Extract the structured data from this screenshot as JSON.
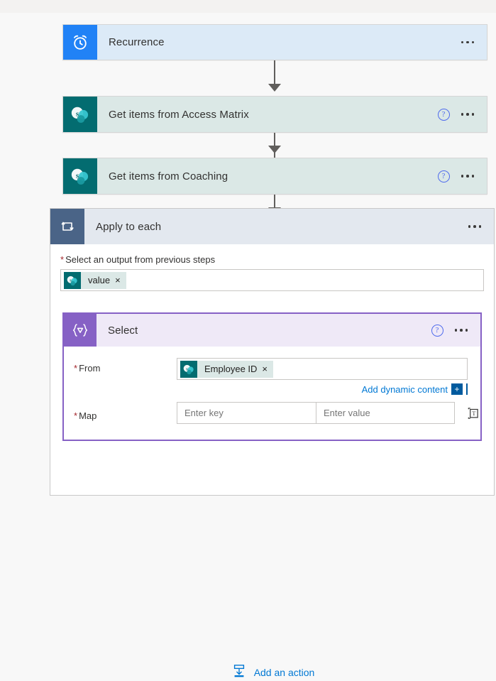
{
  "flow": {
    "steps": [
      {
        "id": "recurrence",
        "title": "Recurrence",
        "icon": "alarm-clock-icon",
        "icon_color": "#2182f6",
        "body_color": "#dceaf7",
        "has_help": false
      },
      {
        "id": "get-items-access-matrix",
        "title": "Get items from Access Matrix",
        "icon": "sharepoint-icon",
        "icon_color": "#036c70",
        "body_color": "#dbe8e6",
        "has_help": true
      },
      {
        "id": "get-items-coaching",
        "title": "Get items from Coaching",
        "icon": "sharepoint-icon",
        "icon_color": "#036c70",
        "body_color": "#dbe8e6",
        "has_help": true
      }
    ],
    "apply_to_each": {
      "title": "Apply to each",
      "icon": "loop-icon",
      "icon_color": "#4a6487",
      "header_color": "#e3e8ef",
      "output_field": {
        "label": "Select an output from previous steps",
        "required_marker": "*",
        "token": {
          "text": "value",
          "icon": "sharepoint-icon",
          "remove_label": "×"
        }
      },
      "select_action": {
        "title": "Select",
        "icon": "select-braces-icon",
        "icon_color": "#8661c5",
        "header_color": "#efe9f7",
        "border_color": "#8661c5",
        "params": [
          {
            "label": "From",
            "required_marker": "*",
            "token": {
              "text": "Employee ID",
              "icon": "sharepoint-icon",
              "remove_label": "×"
            }
          }
        ],
        "dynamic_content": {
          "label": "Add dynamic content",
          "plus_label": "+"
        },
        "map": {
          "label": "Map",
          "required_marker": "*",
          "key_placeholder": "Enter key",
          "key_value": "",
          "value_placeholder": "Enter value",
          "value_value": "",
          "text_mode_icon": "switch-to-text-mode-icon"
        }
      },
      "add_action": {
        "label": "Add an action",
        "icon": "insert-action-icon"
      }
    },
    "menu_icon": "ellipsis-icon",
    "help_icon": "question-circle-icon",
    "colors": {
      "accent_blue": "#0078d4",
      "purple": "#8661c5",
      "sharepoint_teal": "#036c70",
      "required_red": "#a4262c",
      "connector_gray": "#605e5c"
    }
  }
}
